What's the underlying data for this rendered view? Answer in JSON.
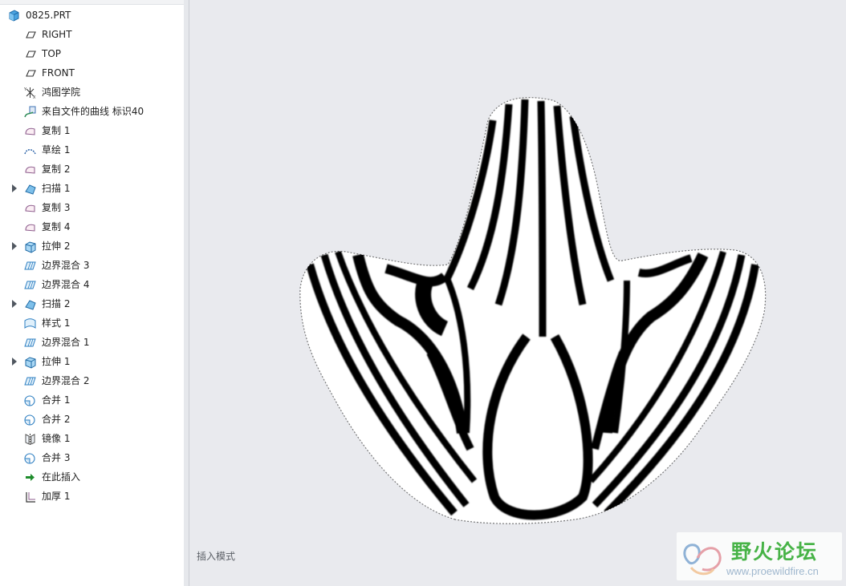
{
  "tree": {
    "root_label": "0825.PRT",
    "items": [
      {
        "label": "RIGHT",
        "icon": "datum-plane-icon",
        "expandable": false
      },
      {
        "label": "TOP",
        "icon": "datum-plane-icon",
        "expandable": false
      },
      {
        "label": "FRONT",
        "icon": "datum-plane-icon",
        "expandable": false
      },
      {
        "label": "鸿图学院",
        "icon": "coordinate-system-icon",
        "expandable": false
      },
      {
        "label": "来自文件的曲线 标识40",
        "icon": "curve-from-file-icon",
        "expandable": false
      },
      {
        "label": "复制 1",
        "icon": "copy-surface-icon",
        "expandable": false
      },
      {
        "label": "草绘 1",
        "icon": "sketch-icon",
        "expandable": false
      },
      {
        "label": "复制 2",
        "icon": "copy-surface-icon",
        "expandable": false
      },
      {
        "label": "扫描 1",
        "icon": "sweep-icon",
        "expandable": true
      },
      {
        "label": "复制 3",
        "icon": "copy-surface-icon",
        "expandable": false
      },
      {
        "label": "复制 4",
        "icon": "copy-surface-icon",
        "expandable": false
      },
      {
        "label": "拉伸 2",
        "icon": "extrude-icon",
        "expandable": true
      },
      {
        "label": "边界混合 3",
        "icon": "boundary-blend-icon",
        "expandable": false
      },
      {
        "label": "边界混合 4",
        "icon": "boundary-blend-icon",
        "expandable": false
      },
      {
        "label": "扫描 2",
        "icon": "sweep-icon",
        "expandable": true
      },
      {
        "label": "样式 1",
        "icon": "style-icon",
        "expandable": false
      },
      {
        "label": "边界混合 1",
        "icon": "boundary-blend-icon",
        "expandable": false
      },
      {
        "label": "拉伸 1",
        "icon": "extrude-icon",
        "expandable": true
      },
      {
        "label": "边界混合 2",
        "icon": "boundary-blend-icon",
        "expandable": false
      },
      {
        "label": "合并 1",
        "icon": "merge-icon",
        "expandable": false
      },
      {
        "label": "合并 2",
        "icon": "merge-icon",
        "expandable": false
      },
      {
        "label": "镜像 1",
        "icon": "mirror-icon",
        "expandable": false
      },
      {
        "label": "合并 3",
        "icon": "merge-icon",
        "expandable": false
      },
      {
        "label": "在此插入",
        "icon": "insert-here-arrow-icon",
        "expandable": false
      },
      {
        "label": "加厚 1",
        "icon": "thicken-icon",
        "expandable": false
      }
    ]
  },
  "viewport": {
    "mode_text": "插入模式",
    "model_icon": "zebra-striped-surface-model"
  },
  "watermark": {
    "title": "野火论坛",
    "url": "www.proewildfire.cn",
    "logo_icon": "forum-logo-icon"
  },
  "colors": {
    "viewport_bg": "#e9eaee",
    "tree_bg": "#ffffff",
    "stripe_dark": "#000000",
    "stripe_light": "#ffffff",
    "watermark_green": "#47b347",
    "watermark_url": "#9fb7ce"
  }
}
